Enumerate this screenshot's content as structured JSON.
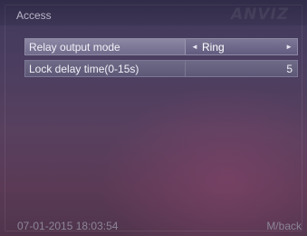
{
  "header": {
    "title": "Access",
    "brand": "ANVIZ"
  },
  "rows": [
    {
      "label": "Relay output mode",
      "value": "Ring",
      "left_arrow": "◄",
      "right_arrow": "►"
    },
    {
      "label": "Lock delay time(0-15s)",
      "value": "5"
    }
  ],
  "footer": {
    "datetime": "07-01-2015 18:03:54",
    "back_label": "M/back"
  }
}
